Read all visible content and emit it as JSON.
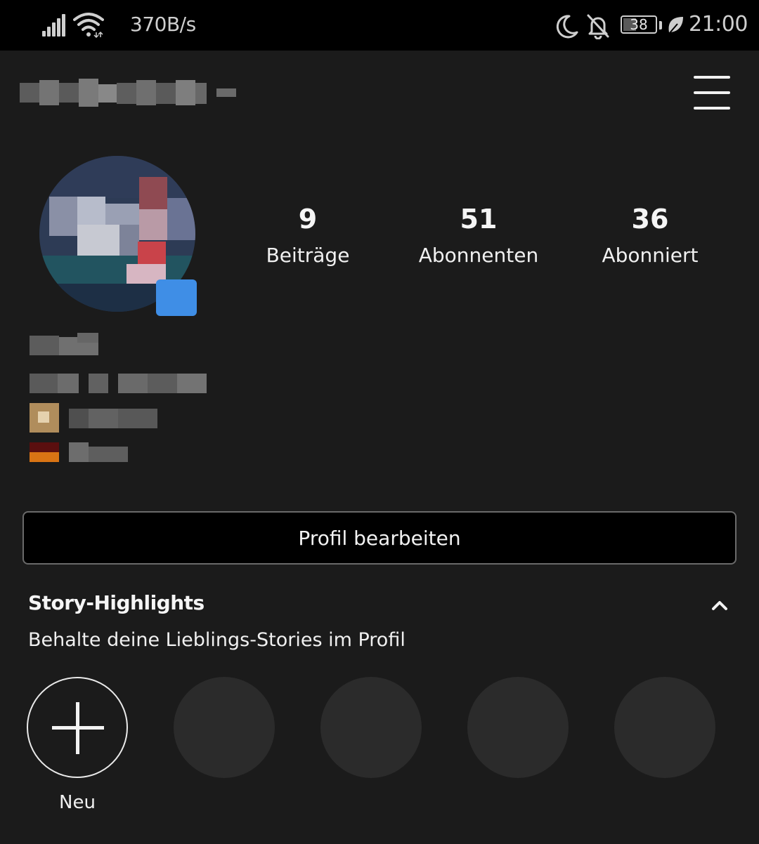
{
  "status_bar": {
    "net_speed": "370B/s",
    "battery_level": "38",
    "time": "21:00"
  },
  "profile": {
    "stats": [
      {
        "value": "9",
        "label": "Beiträge"
      },
      {
        "value": "51",
        "label": "Abonnenten"
      },
      {
        "value": "36",
        "label": "Abonniert"
      }
    ],
    "edit_button": "Profil bearbeiten"
  },
  "highlights": {
    "title": "Story-Highlights",
    "subtitle": "Behalte deine Lieblings-Stories im Profil",
    "new_label": "Neu"
  },
  "colors": {
    "background": "#1b1b1b",
    "status_bar": "#000000",
    "placeholder_circle": "#2b2b2b",
    "accent_badge": "#3f8ee6"
  },
  "icons": {
    "status": [
      "signal-icon",
      "wifi-icon",
      "moon-icon",
      "bell-off-icon",
      "battery-icon",
      "leaf-icon"
    ],
    "header": [
      "menu-icon"
    ],
    "highlights": [
      "chevron-up-icon",
      "plus-icon"
    ]
  }
}
